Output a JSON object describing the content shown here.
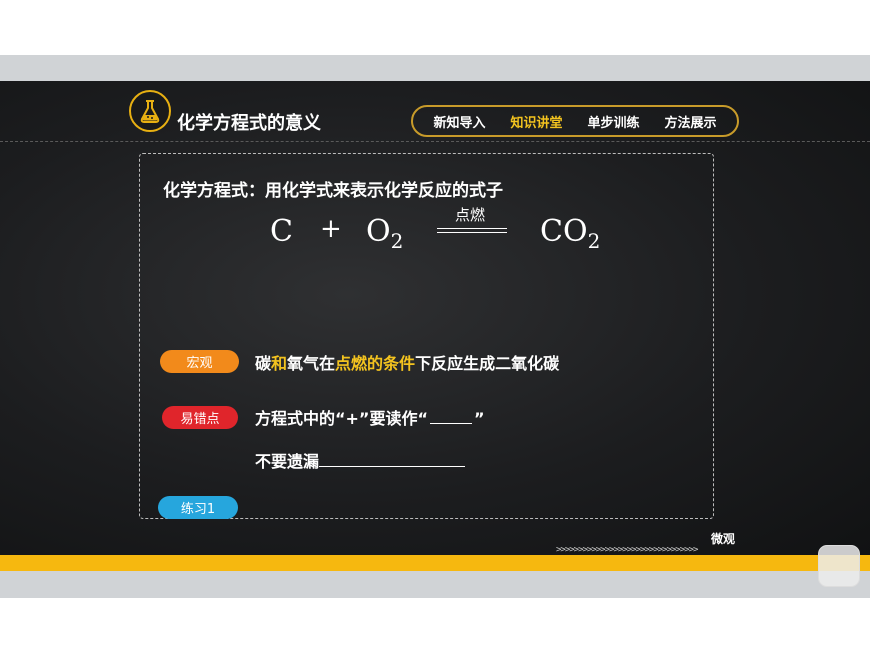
{
  "header": {
    "title": "化学方程式的意义",
    "nav": [
      "新知导入",
      "知识讲堂",
      "单步训练",
      "方法展示"
    ],
    "active_nav": "知识讲堂"
  },
  "panel": {
    "definition": "化学方程式：用化学式来表示化学反应的式子",
    "equation": {
      "reactant1": "C",
      "plus": "+",
      "reactant2": "O",
      "reactant2_sub": "2",
      "condition": "点燃",
      "product": "CO",
      "product_sub": "2"
    },
    "macro_tag": "宏观",
    "macro_text": {
      "a": "碳",
      "b": "和",
      "c": "氧气在",
      "d": "点燃的条件",
      "e": "下反应生成二氧化碳"
    },
    "error_tag": "易错点",
    "error_line1_a": "方程式中的“+”要读作“",
    "error_line1_b": "”",
    "error_line2": "不要遗漏",
    "exercise_tag": "练习1"
  },
  "footer": {
    "label": "微观",
    "chevrons": ">>>>>>>>>>>>>>>>>>>>>>>>>>>>>>>>"
  },
  "colors": {
    "accent_yellow": "#f3c31f",
    "stripe": "#f6b80f",
    "macro_tag": "#f28a1b",
    "error_tag": "#e0252b",
    "exercise_tag": "#26a6dd"
  },
  "icons": {
    "logo": "flask-icon"
  }
}
